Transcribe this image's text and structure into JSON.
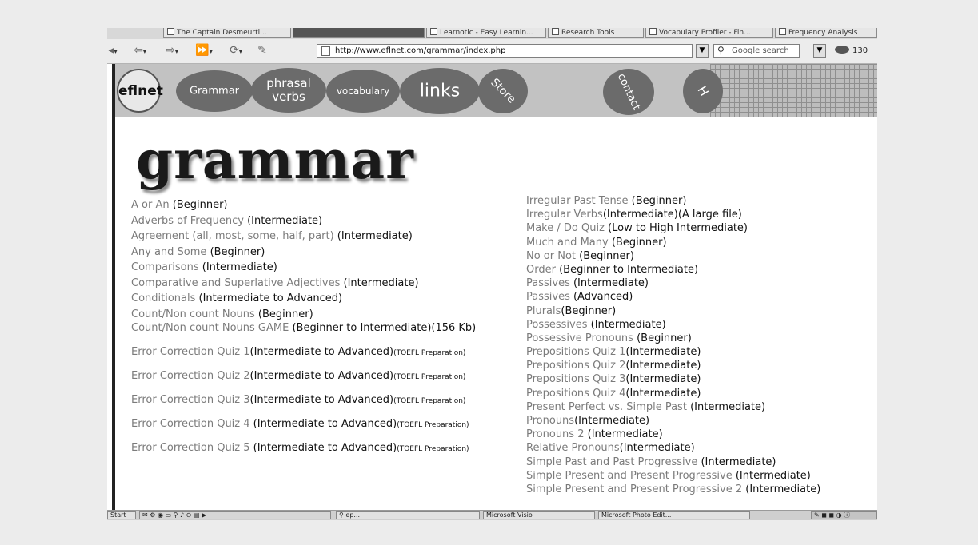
{
  "browser": {
    "tabs": [
      {
        "label": "The Captain Desmeurti..."
      },
      {
        "label": ""
      },
      {
        "label": "Learnotic - Easy Learnin..."
      },
      {
        "label": "Research Tools"
      },
      {
        "label": "Vocabulary Profiler - Fin..."
      },
      {
        "label": "Frequency Analysis"
      }
    ],
    "address_url": "http://www.eflnet.com/grammar/index.php",
    "search_placeholder": "Google search",
    "zoom_label": "130"
  },
  "site": {
    "logo": "eflnet",
    "nav": [
      {
        "label": "Grammar"
      },
      {
        "label": "phrasal verbs"
      },
      {
        "label": "vocabulary"
      },
      {
        "label": "links"
      },
      {
        "label": "Store"
      },
      {
        "label": "contact"
      },
      {
        "label": "H"
      }
    ],
    "page_title": "grammar"
  },
  "left_links": [
    {
      "title": "A or An",
      "level": "(Beginner)"
    },
    {
      "title": "Adverbs of Frequency",
      "level": "(Intermediate)"
    },
    {
      "title": "Agreement (all, most, some, half, part)",
      "level": "(Intermediate)"
    },
    {
      "title": "Any and Some",
      "level": "(Beginner)"
    },
    {
      "title": "Comparisons",
      "level": "(Intermediate)"
    },
    {
      "title": "Comparative and Superlative Adjectives",
      "level": "(Intermediate)"
    },
    {
      "title": "Conditionals",
      "level": "(Intermediate to Advanced)"
    },
    {
      "title": "Count/Non count Nouns",
      "level": "(Beginner)"
    },
    {
      "title": "Count/Non count Nouns GAME",
      "level": "(Beginner to Intermediate)(156 Kb)"
    },
    {
      "title": "Error Correction Quiz 1",
      "level": "(Intermediate to Advanced)",
      "note": "(TOEFL Preparation)"
    },
    {
      "title": "Error Correction Quiz 2",
      "level": "(Intermediate to Advanced)",
      "note": "(TOEFL Preparation)"
    },
    {
      "title": "Error Correction Quiz 3",
      "level": "(Intermediate to Advanced)",
      "note": "(TOEFL Preparation)"
    },
    {
      "title": "Error Correction Quiz 4",
      "level": "(Intermediate to Advanced)",
      "note": "(TOEFL Preparation)"
    },
    {
      "title": "Error Correction Quiz 5",
      "level": "(Intermediate to Advanced)",
      "note": "(TOEFL Preparation)"
    }
  ],
  "right_links": [
    {
      "title": "Irregular Past Tense",
      "level": "(Beginner)"
    },
    {
      "title": "Irregular Verbs",
      "level": "(Intermediate)(A large file)"
    },
    {
      "title": "Make / Do Quiz",
      "level": "(Low to High Intermediate)"
    },
    {
      "title": "Much and Many",
      "level": "(Beginner)"
    },
    {
      "title": "No or Not",
      "level": "(Beginner)"
    },
    {
      "title": "Order",
      "level": "(Beginner to Intermediate)"
    },
    {
      "title": "Passives",
      "level": "(Intermediate)"
    },
    {
      "title": "Passives",
      "level": "(Advanced)"
    },
    {
      "title": "Plurals",
      "level": "(Beginner)"
    },
    {
      "title": "Possessives",
      "level": "(Intermediate)"
    },
    {
      "title": "Possessive Pronouns",
      "level": "(Beginner)"
    },
    {
      "title": "Prepositions Quiz 1",
      "level": "(Intermediate)"
    },
    {
      "title": "Prepositions Quiz 2",
      "level": "(Intermediate)"
    },
    {
      "title": "Prepositions Quiz 3",
      "level": "(Intermediate)"
    },
    {
      "title": "Prepositions Quiz 4",
      "level": "(Intermediate)"
    },
    {
      "title": "Present Perfect vs. Simple Past",
      "level": "(Intermediate)"
    },
    {
      "title": "Pronouns",
      "level": "(Intermediate)"
    },
    {
      "title": "Pronouns 2",
      "level": "(Intermediate)"
    },
    {
      "title": "Relative Pronouns",
      "level": "(Intermediate)"
    },
    {
      "title": "Simple Past and Past Progressive",
      "level": "(Intermediate)"
    },
    {
      "title": "Simple Present and Present Progressive",
      "level": "(Intermediate)"
    },
    {
      "title": "Simple Present and Present Progressive 2",
      "level": "(Intermediate)"
    }
  ],
  "taskbar": {
    "items": [
      {
        "label": "Start"
      },
      {
        "label": "ep..."
      },
      {
        "label": "Microsoft Visio"
      },
      {
        "label": "Microsoft Photo Edit..."
      }
    ]
  }
}
